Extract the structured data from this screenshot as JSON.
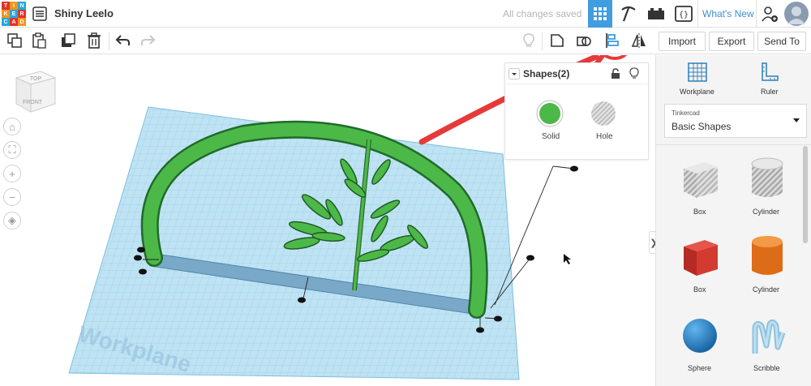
{
  "app": {
    "logo_letters": [
      "T",
      "I",
      "N",
      "K",
      "E",
      "R",
      "C",
      "A",
      "D"
    ],
    "project_title": "Shiny Leelo",
    "save_status": "All changes saved",
    "whats_new": "What's New"
  },
  "toolbar": {
    "import_label": "Import",
    "export_label": "Export",
    "send_to_label": "Send To"
  },
  "viewcube": {
    "top_label": "TOP",
    "front_label": "FRONT"
  },
  "workplane_label": "Workplane",
  "inspector": {
    "title": "Shapes(2)",
    "solid_label": "Solid",
    "hole_label": "Hole"
  },
  "sidebar": {
    "workplane_tool": "Workplane",
    "ruler_tool": "Ruler",
    "library_category": "Tinkercad",
    "library_value": "Basic Shapes",
    "shapes": [
      {
        "label": "Box"
      },
      {
        "label": "Cylinder"
      },
      {
        "label": "Box"
      },
      {
        "label": "Cylinder"
      },
      {
        "label": "Sphere"
      },
      {
        "label": "Scribble"
      }
    ]
  },
  "colors": {
    "accent": "#3f9de0",
    "solid": "#4cb848",
    "annotation": "#e63a3a",
    "grid": "#a9d6ec"
  }
}
